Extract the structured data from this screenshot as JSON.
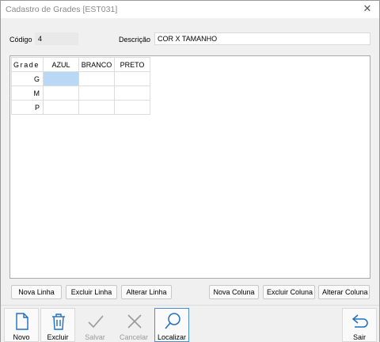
{
  "window": {
    "title": "Cadastro de Grades [EST031]",
    "close_symbol": "✕"
  },
  "form": {
    "codigo_label": "Código",
    "codigo_value": "4",
    "descricao_label": "Descrição",
    "descricao_value": "COR X TAMANHO"
  },
  "grid": {
    "corner_label": "Grade",
    "columns": [
      "AZUL",
      "BRANCO",
      "PRETO"
    ],
    "rows": [
      "G",
      "M",
      "P"
    ],
    "selected_cell": "G/AZUL"
  },
  "grid_buttons": {
    "nova_linha": "Nova Linha",
    "excluir_linha": "Excluir Linha",
    "alterar_linha": "Alterar Linha",
    "nova_coluna": "Nova Coluna",
    "excluir_coluna": "Excluir Coluna",
    "alterar_coluna": "Alterar Coluna"
  },
  "toolbar": {
    "novo": "Novo",
    "excluir": "Excluir",
    "salvar": "Salvar",
    "cancelar": "Cancelar",
    "localizar": "Localizar",
    "sair": "Sair"
  },
  "icons": {
    "novo": "new-document-icon",
    "excluir": "trash-icon",
    "salvar": "checkmark-icon",
    "cancelar": "cancel-x-icon",
    "localizar": "search-icon",
    "sair": "exit-arrow-icon"
  },
  "colors": {
    "accent_blue": "#1e6fc0",
    "selected_cell": "#b9d8f5",
    "disabled_gray": "#9a9a9a"
  }
}
